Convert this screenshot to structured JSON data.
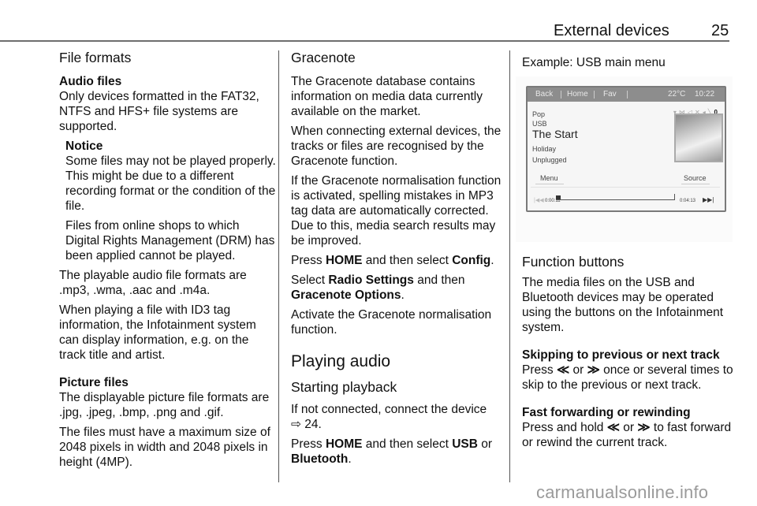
{
  "header": {
    "title": "External devices",
    "page_number": "25"
  },
  "col1": {
    "section_title": "File formats",
    "audio_heading": "Audio files",
    "audio_intro": "Only devices formatted in the FAT32, NTFS and HFS+ file systems are supported.",
    "notice_heading": "Notice",
    "notice_p1": "Some files may not be played properly. This might be due to a different recording format or the condition of the file.",
    "notice_p2": "Files from online shops to which Digital Rights Management (DRM) has been applied cannot be played.",
    "formats_p": "The playable audio file formats are .mp3, .wma, .aac and .m4a.",
    "id3_p": "When playing a file with ID3 tag information, the Infotainment system can display information, e.g. on the track title and artist.",
    "picture_heading": "Picture files",
    "picture_p1": "The displayable picture file formats are .jpg, .jpeg, .bmp, .png and .gif.",
    "picture_p2": "The files must have a maximum size of 2048 pixels in width and 2048 pixels in height (4MP)."
  },
  "col2": {
    "gracenote_heading": "Gracenote",
    "g_p1": "The Gracenote database contains information on media data currently available on the market.",
    "g_p2": "When connecting external devices, the tracks or files are recognised by the Gracenote function.",
    "g_p3": "If the Gracenote normalisation function is activated, spelling mistakes in MP3 tag data are automatically corrected. Due to this, media search results may be improved.",
    "g_p4": {
      "pre": "Press ",
      "b1": "HOME",
      "mid": " and then select ",
      "b2": "Config",
      "post": "."
    },
    "g_p5": {
      "pre": "Select ",
      "b1": "Radio Settings",
      "mid": " and then ",
      "b2": "Gracenote Options",
      "post": "."
    },
    "g_p6": "Activate the Gracenote normalisation function.",
    "playing_heading": "Playing audio",
    "starting_heading": "Starting playback",
    "s_p1": "If not connected, connect the device",
    "s_p1_ref": "⇨ 24.",
    "s_p2": {
      "pre": "Press ",
      "b1": "HOME",
      "mid": " and then select ",
      "b2": "USB",
      "mid2": " or ",
      "b3": "Bluetooth",
      "post": "."
    }
  },
  "col3": {
    "example_caption": "Example: USB main menu",
    "screen": {
      "nav": [
        "Back",
        "Home",
        "Fav"
      ],
      "temperature": "22°C",
      "time": "10:22",
      "lines": [
        "Pop",
        "USB"
      ],
      "track_title": "The Start",
      "album": "Holiday",
      "artist": "Unplugged",
      "menu_button": "Menu",
      "source_button": "Source",
      "elapsed": "0:00:11",
      "total": "0:04:13",
      "progress_fraction": 0.04,
      "prev_icon": "|◀◀",
      "next_icon": "▶▶|"
    },
    "function_heading": "Function buttons",
    "f_p1": "The media files on the USB and Bluetooth devices may be operated using the buttons on the Infotainment system.",
    "skip_heading": "Skipping to previous or next track",
    "skip_p": {
      "pre": "Press ",
      "b1": "≪",
      "mid": " or ",
      "b2": "≫",
      "post": " once or several times to skip to the previous or next track."
    },
    "ff_heading": "Fast forwarding or rewinding",
    "ff_p": {
      "pre": "Press and hold ",
      "b1": "≪",
      "mid": " or ",
      "b2": "≫",
      "post": " to fast forward or rewind the current track."
    }
  },
  "watermark": "carmanualsonline.info"
}
